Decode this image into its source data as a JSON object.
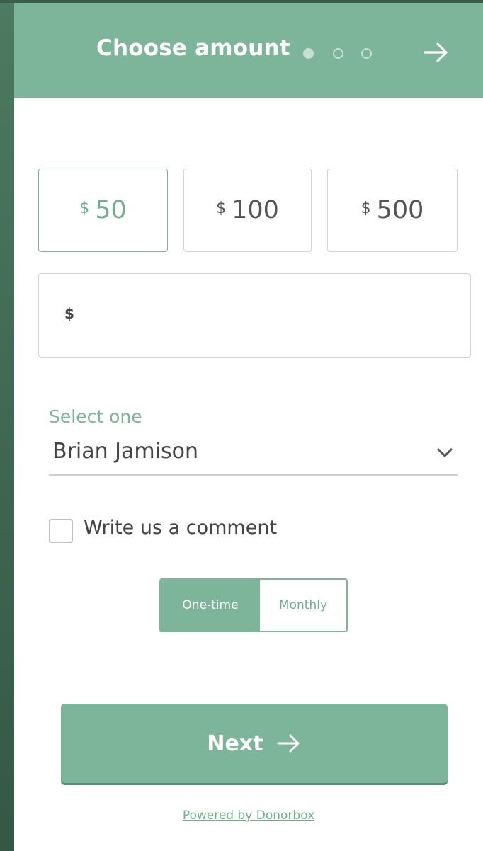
{
  "header": {
    "title": "Choose amount",
    "steps_total": 3,
    "current_step": 1,
    "next_icon": "arrow-right-icon"
  },
  "amounts": [
    {
      "currency": "$",
      "value": "50",
      "selected": true
    },
    {
      "currency": "$",
      "value": "100",
      "selected": false
    },
    {
      "currency": "$",
      "value": "500",
      "selected": false
    }
  ],
  "custom_amount": {
    "currency": "$",
    "value": ""
  },
  "select": {
    "label": "Select one",
    "value": "Brian Jamison"
  },
  "comment": {
    "label": "Write us a comment",
    "checked": false
  },
  "frequency": {
    "options": [
      "One-time",
      "Monthly"
    ],
    "selected": "One-time"
  },
  "next_button": {
    "label": "Next"
  },
  "footer": {
    "powered_by": "Powered by Donorbox"
  },
  "colors": {
    "accent": "#7db59a",
    "accent_text": "#6fae90",
    "background": "#3f6a52"
  }
}
